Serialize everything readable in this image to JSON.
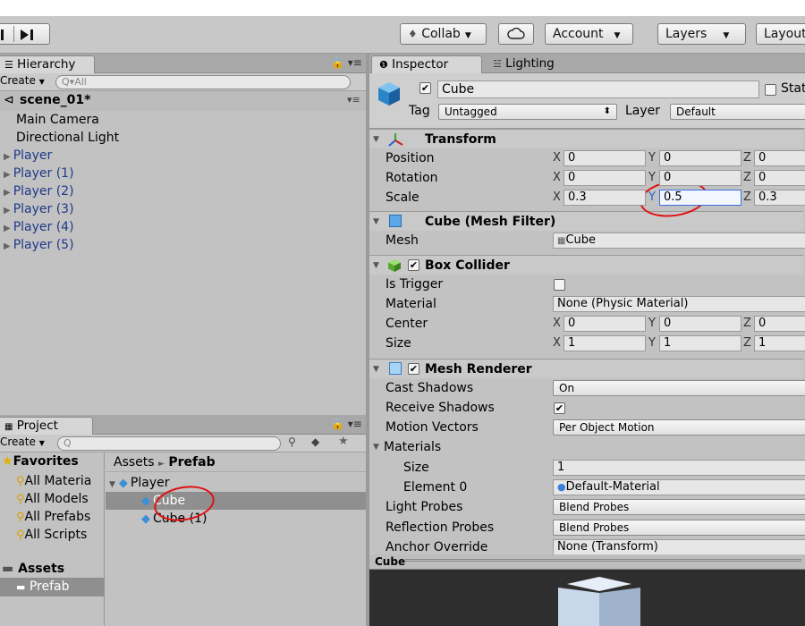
{
  "toolbar": {
    "collab": "Collab",
    "account": "Account",
    "layers": "Layers",
    "layout": "Layout"
  },
  "hierarchy": {
    "tab": "Hierarchy",
    "create": "Create",
    "search_placeholder": "All",
    "scene": "scene_01*",
    "items": [
      {
        "label": "Main Camera",
        "expandable": false
      },
      {
        "label": "Directional Light",
        "expandable": false
      },
      {
        "label": "Player",
        "expandable": true
      },
      {
        "label": "Player (1)",
        "expandable": true
      },
      {
        "label": "Player (2)",
        "expandable": true
      },
      {
        "label": "Player (3)",
        "expandable": true
      },
      {
        "label": "Player (4)",
        "expandable": true
      },
      {
        "label": "Player (5)",
        "expandable": true
      }
    ]
  },
  "project": {
    "tab": "Project",
    "create": "Create",
    "favorites_label": "Favorites",
    "favorites": [
      "All Materia",
      "All Models",
      "All Prefabs",
      "All Scripts"
    ],
    "assets_label": "Assets",
    "prefab_folder": "Prefab",
    "breadcrumb_root": "Assets",
    "breadcrumb_sep": "►",
    "breadcrumb_current": "Prefab",
    "tree": [
      {
        "label": "Player",
        "level": 0
      },
      {
        "label": "Cube",
        "level": 1,
        "selected": true
      },
      {
        "label": "Cube (1)",
        "level": 1,
        "selected": false
      }
    ]
  },
  "inspector": {
    "tab": "Inspector",
    "lighting_tab": "Lighting",
    "object_name": "Cube",
    "static_label": "Stat",
    "tag_label": "Tag",
    "tag_value": "Untagged",
    "layer_label": "Layer",
    "layer_value": "Default",
    "transform": {
      "title": "Transform",
      "position_label": "Position",
      "rotation_label": "Rotation",
      "scale_label": "Scale",
      "position": {
        "x": "0",
        "y": "0",
        "z": "0"
      },
      "rotation": {
        "x": "0",
        "y": "0",
        "z": "0"
      },
      "scale": {
        "x": "0.3",
        "y": "0.5",
        "z": "0.3"
      }
    },
    "mesh_filter": {
      "title": "Cube (Mesh Filter)",
      "mesh_label": "Mesh",
      "mesh_value": "Cube"
    },
    "box_collider": {
      "title": "Box Collider",
      "is_trigger_label": "Is Trigger",
      "material_label": "Material",
      "material_value": "None (Physic Material)",
      "center_label": "Center",
      "size_label": "Size",
      "center": {
        "x": "0",
        "y": "0",
        "z": "0"
      },
      "size": {
        "x": "1",
        "y": "1",
        "z": "1"
      }
    },
    "mesh_renderer": {
      "title": "Mesh Renderer",
      "cast_shadows_label": "Cast Shadows",
      "cast_shadows_value": "On",
      "receive_shadows_label": "Receive Shadows",
      "motion_vectors_label": "Motion Vectors",
      "motion_vectors_value": "Per Object Motion",
      "materials_label": "Materials",
      "size_label": "Size",
      "size_value": "1",
      "element0_label": "Element 0",
      "element0_value": "Default-Material",
      "light_probes_label": "Light Probes",
      "light_probes_value": "Blend Probes",
      "reflection_probes_label": "Reflection Probes",
      "reflection_probes_value": "Blend Probes",
      "anchor_override_label": "Anchor Override",
      "anchor_override_value": "None (Transform)"
    },
    "axis": {
      "x": "X",
      "y": "Y",
      "z": "Z"
    }
  },
  "preview": {
    "title": "Cube"
  },
  "colors": {
    "annotation": "#e01010",
    "selection": "#8f8f8f",
    "hierarchy_link": "#1e3a8a"
  }
}
